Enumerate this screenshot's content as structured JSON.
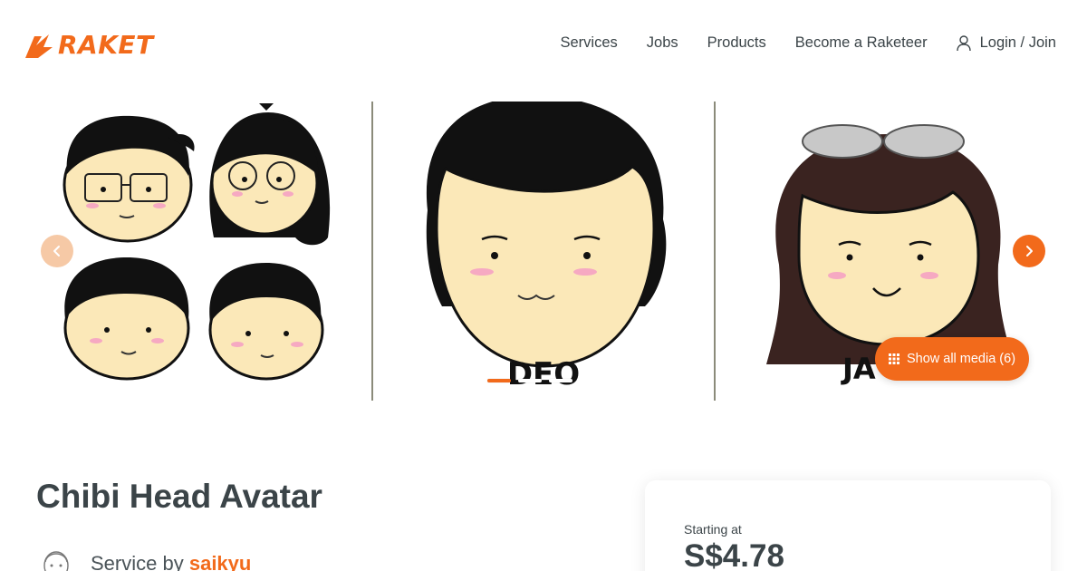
{
  "brand": {
    "name": "RAKET",
    "accent": "#f26a1b",
    "text_color": "#3b4448"
  },
  "nav": {
    "items": [
      "Services",
      "Jobs",
      "Products",
      "Become a Raketeer"
    ],
    "login_label": "Login / Join",
    "login_icon": "user-icon"
  },
  "gallery": {
    "slide_count_visible": 3,
    "prev_icon": "chevron-left-icon",
    "next_icon": "chevron-right-icon",
    "dots_total": 3,
    "active_dot": 0,
    "show_media_label": "Show all media (6)",
    "show_media_icon": "grid-icon",
    "slide_texts": [
      "DEO",
      "JA"
    ]
  },
  "service": {
    "title": "Chibi Head Avatar",
    "by_label": "Service by",
    "seller": "saikyu"
  },
  "pricing": {
    "label": "Starting at",
    "value": "S$4.78"
  }
}
